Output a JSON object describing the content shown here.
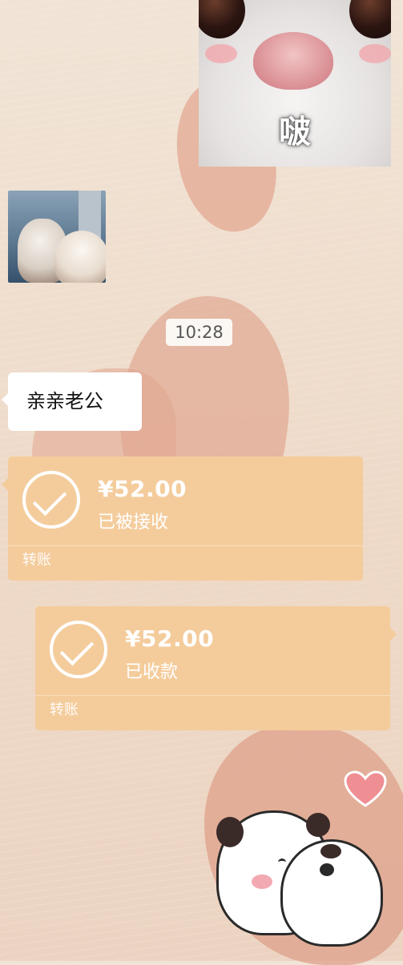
{
  "messages": {
    "sticker_cat": {
      "caption": "啵"
    },
    "timestamp": "10:28",
    "text_message": "亲亲老公",
    "transfer_received": {
      "amount": "¥52.00",
      "status": "已被接收",
      "label": "转账"
    },
    "transfer_sent": {
      "amount": "¥52.00",
      "status": "已收款",
      "label": "转账"
    }
  },
  "colors": {
    "transfer_card": "#f4cc9c",
    "bubble_white": "#ffffff",
    "wallpaper": "#eed9c7"
  },
  "icons": {
    "check": "check-circle-icon",
    "heart": "heart-icon"
  }
}
